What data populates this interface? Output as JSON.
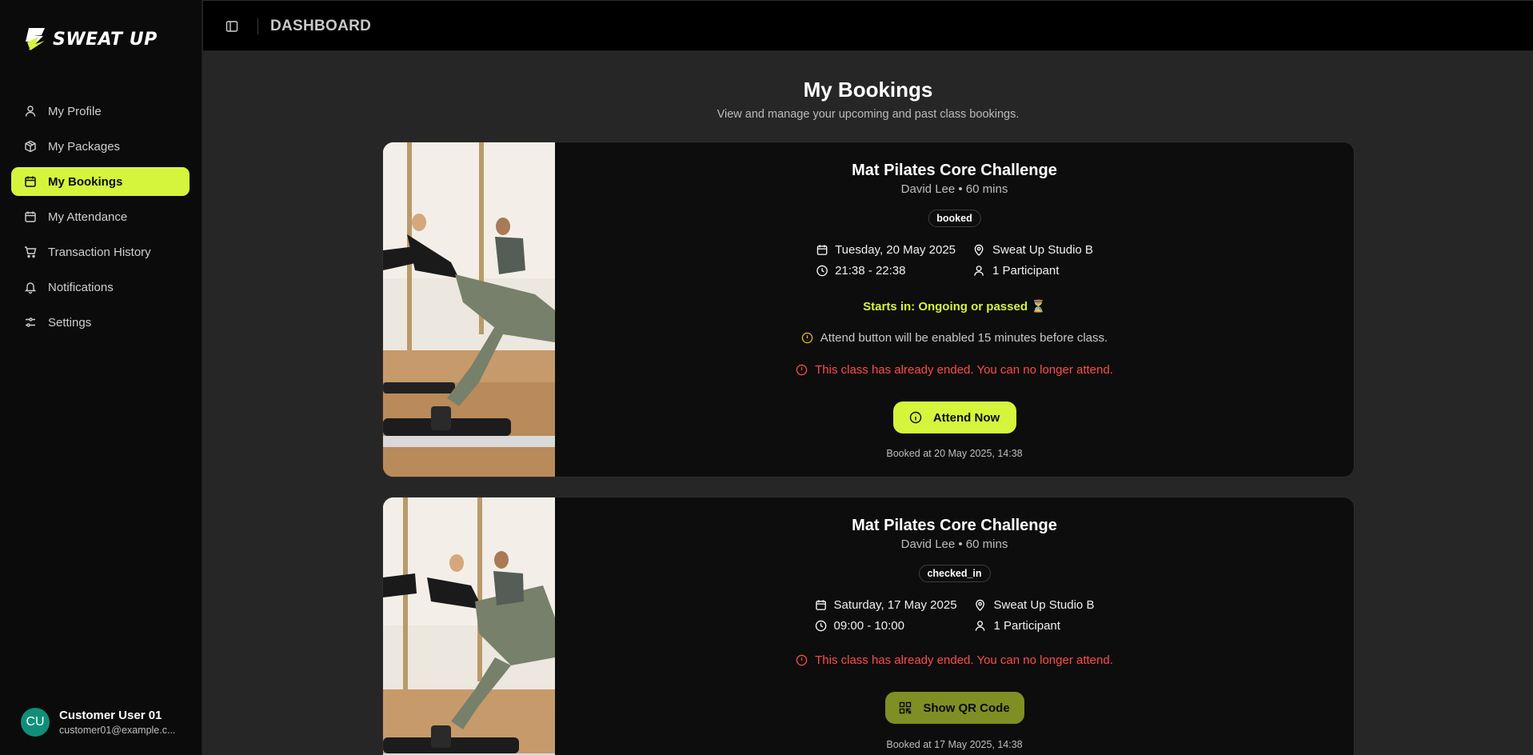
{
  "brand": {
    "name": "SWEAT UP",
    "accent": "#d4f53c"
  },
  "header": {
    "title": "DASHBOARD"
  },
  "sidebar": {
    "items": [
      {
        "label": "My Profile",
        "icon": "user-icon"
      },
      {
        "label": "My Packages",
        "icon": "package-icon"
      },
      {
        "label": "My Bookings",
        "icon": "calendar-icon",
        "active": true
      },
      {
        "label": "My Attendance",
        "icon": "calendar-icon"
      },
      {
        "label": "Transaction History",
        "icon": "cart-icon"
      },
      {
        "label": "Notifications",
        "icon": "bell-icon"
      },
      {
        "label": "Settings",
        "icon": "sliders-icon"
      }
    ]
  },
  "user": {
    "initials": "CU",
    "name": "Customer User 01",
    "email": "customer01@example.c..."
  },
  "main": {
    "title": "My Bookings",
    "subtitle": "View and manage your upcoming and past class bookings."
  },
  "bookings": [
    {
      "title": "Mat Pilates Core Challenge",
      "meta": "David Lee • 60 mins",
      "status": "booked",
      "date": "Tuesday, 20 May 2025",
      "time": "21:38 - 22:38",
      "location": "Sweat Up Studio B",
      "participants": "1 Participant",
      "starts_in": "Starts in: Ongoing or passed ⏳",
      "notice": "Attend button will be enabled 15 minutes before class.",
      "error": "This class has already ended. You can no longer attend.",
      "action_label": "Attend Now",
      "booked_at": "Booked at 20 May 2025, 14:38"
    },
    {
      "title": "Mat Pilates Core Challenge",
      "meta": "David Lee • 60 mins",
      "status": "checked_in",
      "date": "Saturday, 17 May 2025",
      "time": "09:00 - 10:00",
      "location": "Sweat Up Studio B",
      "participants": "1 Participant",
      "error": "This class has already ended. You can no longer attend.",
      "action_label": "Show QR Code",
      "booked_at": "Booked at 17 May 2025, 14:38"
    }
  ]
}
